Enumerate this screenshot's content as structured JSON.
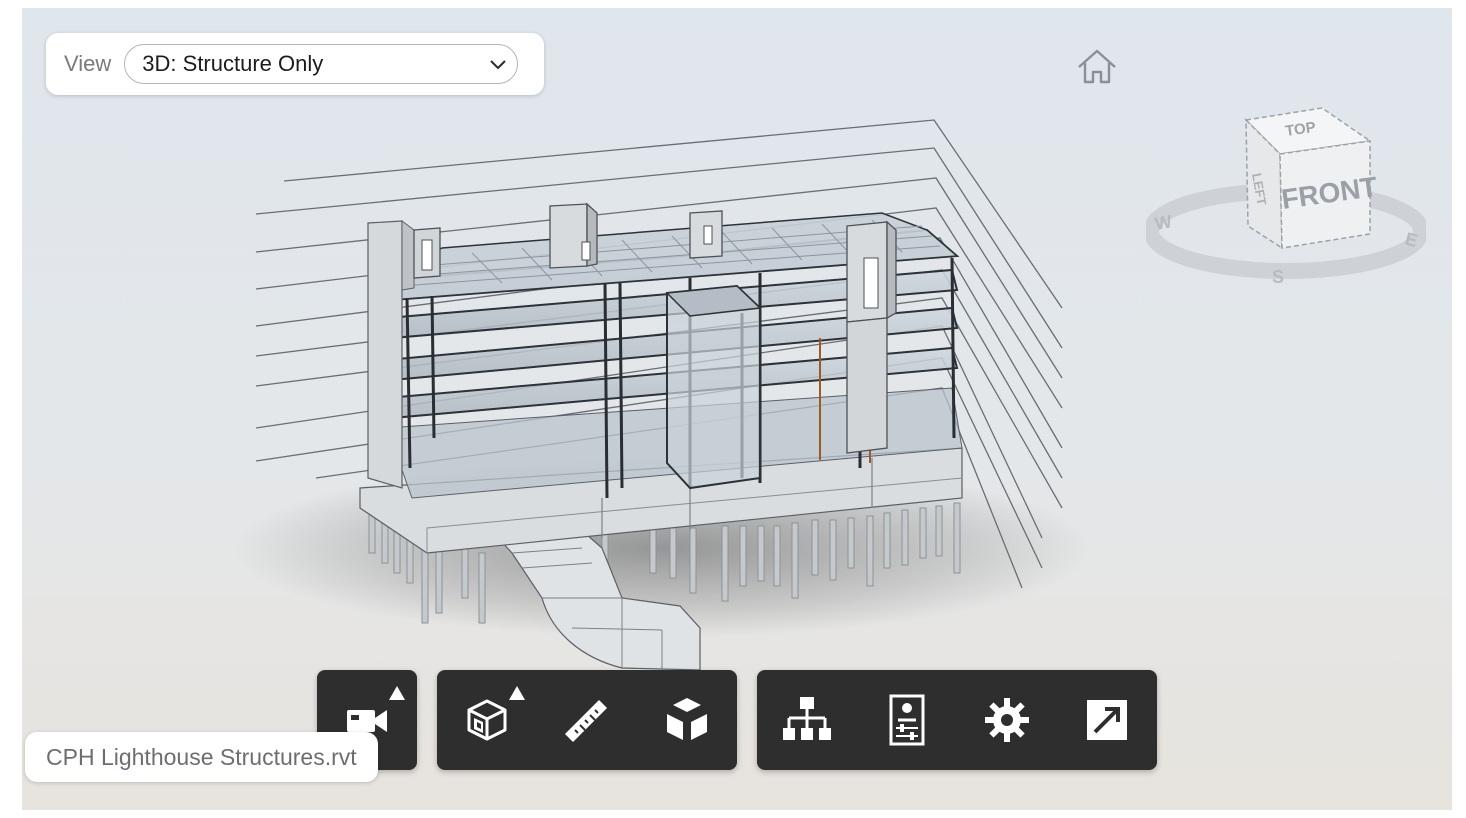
{
  "view_selector": {
    "label": "View",
    "selected": "3D: Structure Only"
  },
  "viewcube": {
    "top": "TOP",
    "front": "FRONT",
    "left": "LEFT",
    "compass": {
      "west": "W",
      "south": "S",
      "east": "E"
    }
  },
  "file": {
    "name": "CPH Lighthouse Structures.rvt"
  },
  "toolbar": {
    "groups": [
      [
        "camera-icon"
      ],
      [
        "section-box-icon",
        "ruler-icon",
        "explode-icon"
      ],
      [
        "model-browser-icon",
        "properties-icon",
        "settings-icon",
        "fullscreen-icon"
      ]
    ]
  },
  "colors": {
    "toolbar_bg": "#2e2e2e",
    "icon": "#ffffff",
    "structure": "#cdd3d9",
    "steel": "#3a3f47"
  }
}
